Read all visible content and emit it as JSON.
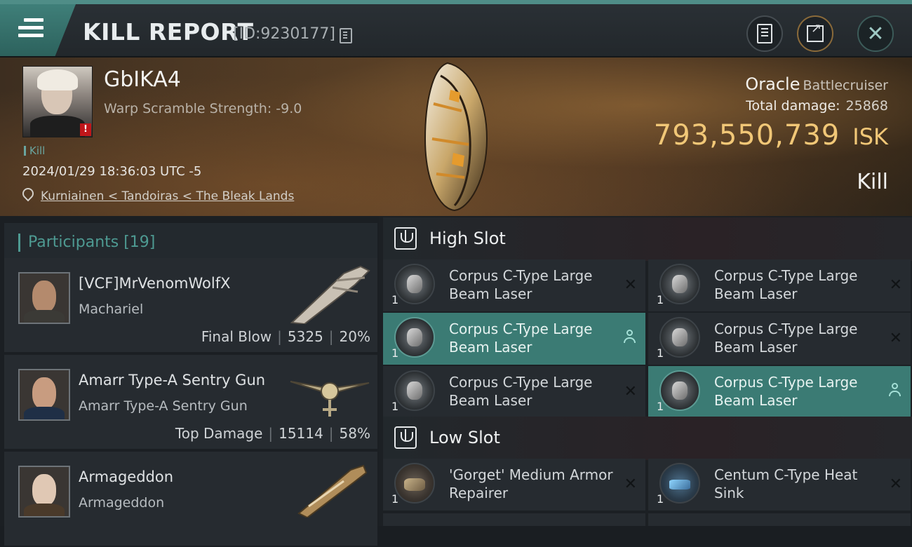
{
  "header": {
    "title": "KILL REPORT",
    "report_id": "[ID:9230177]",
    "icons": [
      "menu-icon",
      "copy-icon",
      "notes-icon",
      "share-icon",
      "close-icon"
    ]
  },
  "victim": {
    "name": "GbIKA4",
    "warp_scramble": "Warp Scramble Strength: -9.0",
    "badge": "!",
    "tag": "Kill",
    "timestamp": "2024/01/29 18:36:03 UTC -5",
    "location": "Kurniainen < Tandoiras < The Bleak Lands",
    "ship_name": "Oracle",
    "ship_class": "Battlecruiser",
    "total_damage_label": "Total damage:",
    "total_damage": "25868",
    "isk_value": "793,550,739",
    "isk_unit": "ISK",
    "result": "Kill"
  },
  "participants": {
    "header": "Participants [19]",
    "rows": [
      {
        "name": "[VCF]MrVenomWolfX",
        "ship": "Machariel",
        "role": "Final Blow",
        "damage": "5325",
        "percent": "20%"
      },
      {
        "name": "Amarr Type-A Sentry Gun",
        "ship": "Amarr Type-A Sentry Gun",
        "role": "Top Damage",
        "damage": "15114",
        "percent": "58%"
      },
      {
        "name": "Armageddon",
        "ship": "Armageddon",
        "role": "",
        "damage": "",
        "percent": ""
      }
    ]
  },
  "fitting": {
    "high_slot": {
      "title": "High Slot",
      "modules": [
        {
          "qty": "1",
          "name": "Corpus C-Type Large Beam Laser",
          "state": "destroyed"
        },
        {
          "qty": "1",
          "name": "Corpus C-Type Large Beam Laser",
          "state": "destroyed"
        },
        {
          "qty": "1",
          "name": "Corpus C-Type Large Beam Laser",
          "state": "dropped"
        },
        {
          "qty": "1",
          "name": "Corpus C-Type Large Beam Laser",
          "state": "destroyed"
        },
        {
          "qty": "1",
          "name": "Corpus C-Type Large Beam Laser",
          "state": "destroyed"
        },
        {
          "qty": "1",
          "name": "Corpus C-Type Large Beam Laser",
          "state": "dropped"
        }
      ]
    },
    "low_slot": {
      "title": "Low Slot",
      "modules": [
        {
          "qty": "1",
          "name": "'Gorget' Medium Armor Repairer",
          "state": "destroyed"
        },
        {
          "qty": "1",
          "name": "Centum C-Type Heat Sink",
          "state": "destroyed"
        }
      ]
    }
  },
  "colors": {
    "accent": "#4f8d87",
    "isk": "#f1c777",
    "active_module": "#3b7b74"
  }
}
